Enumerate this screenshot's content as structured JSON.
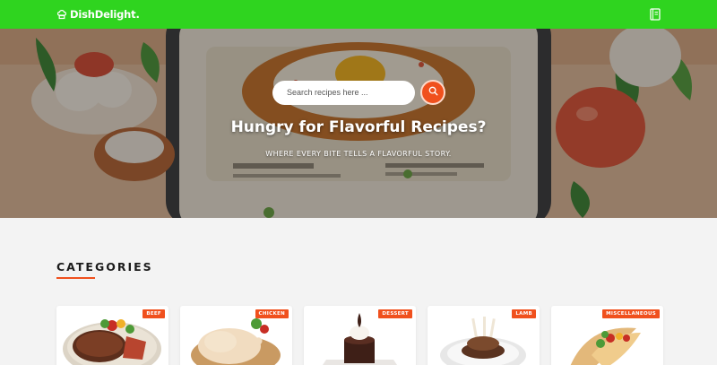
{
  "header": {
    "brand": "DishDelight.",
    "brand_color": "#2fd41f"
  },
  "hero": {
    "search_placeholder": "Search recipes here ...",
    "title": "Hungry for Flavorful Recipes?",
    "subtitle": "WHERE EVERY BITE TELLS A FLAVORFUL STORY.",
    "accent": "#f0501d"
  },
  "categories": {
    "title": "CATEGORIES",
    "items": [
      {
        "label": "BEEF",
        "icon": "steak-icon"
      },
      {
        "label": "CHICKEN",
        "icon": "chicken-icon"
      },
      {
        "label": "DESSERT",
        "icon": "cake-icon"
      },
      {
        "label": "LAMB",
        "icon": "lamb-icon"
      },
      {
        "label": "MISCELLANEOUS",
        "icon": "taco-icon"
      }
    ]
  }
}
